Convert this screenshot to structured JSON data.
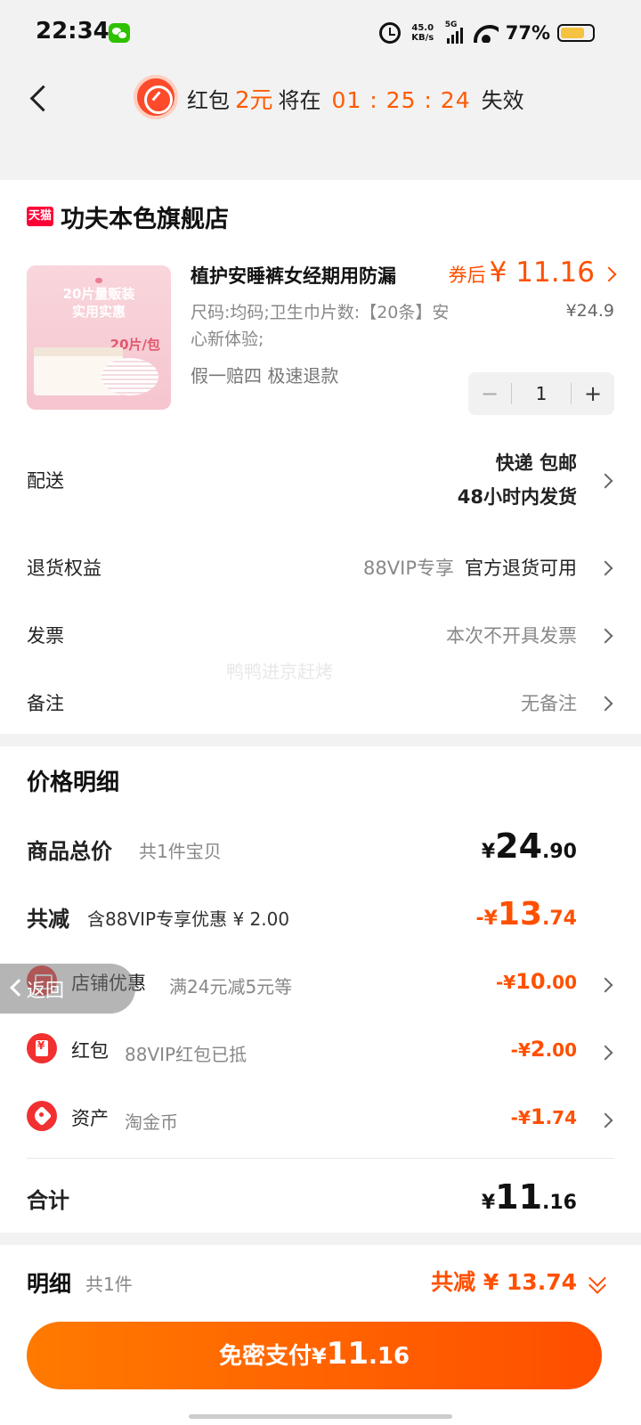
{
  "status_bar": {
    "time": "22:34",
    "net_speed_value": "45.0",
    "net_speed_unit": "KB/s",
    "network_type": "5G",
    "battery_percent": "77%",
    "battery_level": 0.77
  },
  "header": {
    "prefix": "红包",
    "amount": "2元",
    "middle": "将在",
    "countdown": "01 : 25 : 24",
    "suffix": "失效"
  },
  "store": {
    "platform_badge": "天猫",
    "name": "功夫本色旗舰店"
  },
  "product": {
    "image_text_line1": "20片量贩装",
    "image_text_line2": "实用实惠",
    "image_badge": "20片/包",
    "title": "植护安睡裤女经期用防漏",
    "price_label": "券后",
    "price": "¥ 11.16",
    "original_price": "¥24.9",
    "sku": "尺码:均码;卫生巾片数:【20条】安心新体验;",
    "tags": "假一赔四  极速退款",
    "quantity": "1",
    "minus": "−",
    "plus": "+"
  },
  "rows": {
    "delivery_label": "配送",
    "delivery_line1": "快递 包邮",
    "delivery_line2": "48小时内发货",
    "return_label": "退货权益",
    "return_vip": "88VIP专享",
    "return_value": "官方退货可用",
    "invoice_label": "发票",
    "invoice_value": "本次不开具发票",
    "note_label": "备注",
    "note_value": "无备注"
  },
  "watermark": "鸭鸭进京赶烤",
  "price_detail": {
    "title": "价格明细",
    "goods_label": "商品总价",
    "goods_sub": "共1件宝贝",
    "goods_sym": "¥",
    "goods_int": "24",
    "goods_dec": ".90",
    "reduce_label": "共减",
    "reduce_sub": "含88VIP专享优惠 ¥ 2.00",
    "reduce_sym": "-¥",
    "reduce_int": "13",
    "reduce_dec": ".74",
    "shop_label": "店铺优惠",
    "shop_sub": "满24元减5元等",
    "shop_sym": "-¥",
    "shop_int": "10",
    "shop_dec": ".00",
    "hb_label": "红包",
    "hb_sub": "88VIP红包已抵",
    "hb_sym": "-¥",
    "hb_int": "2",
    "hb_dec": ".00",
    "asset_label": "资产",
    "asset_sub": "淘金币",
    "asset_sym": "-¥",
    "asset_int": "1",
    "asset_dec": ".74",
    "total_label": "合计",
    "total_sym": "¥",
    "total_int": "11",
    "total_dec": ".16"
  },
  "float_back": "返回",
  "bottom": {
    "label": "明细",
    "count": "共1件",
    "total_reduce": "共减 ¥ 13.74",
    "pay_text": "免密支付",
    "pay_sym": "¥",
    "pay_int": "11",
    "pay_dec": ".16"
  }
}
